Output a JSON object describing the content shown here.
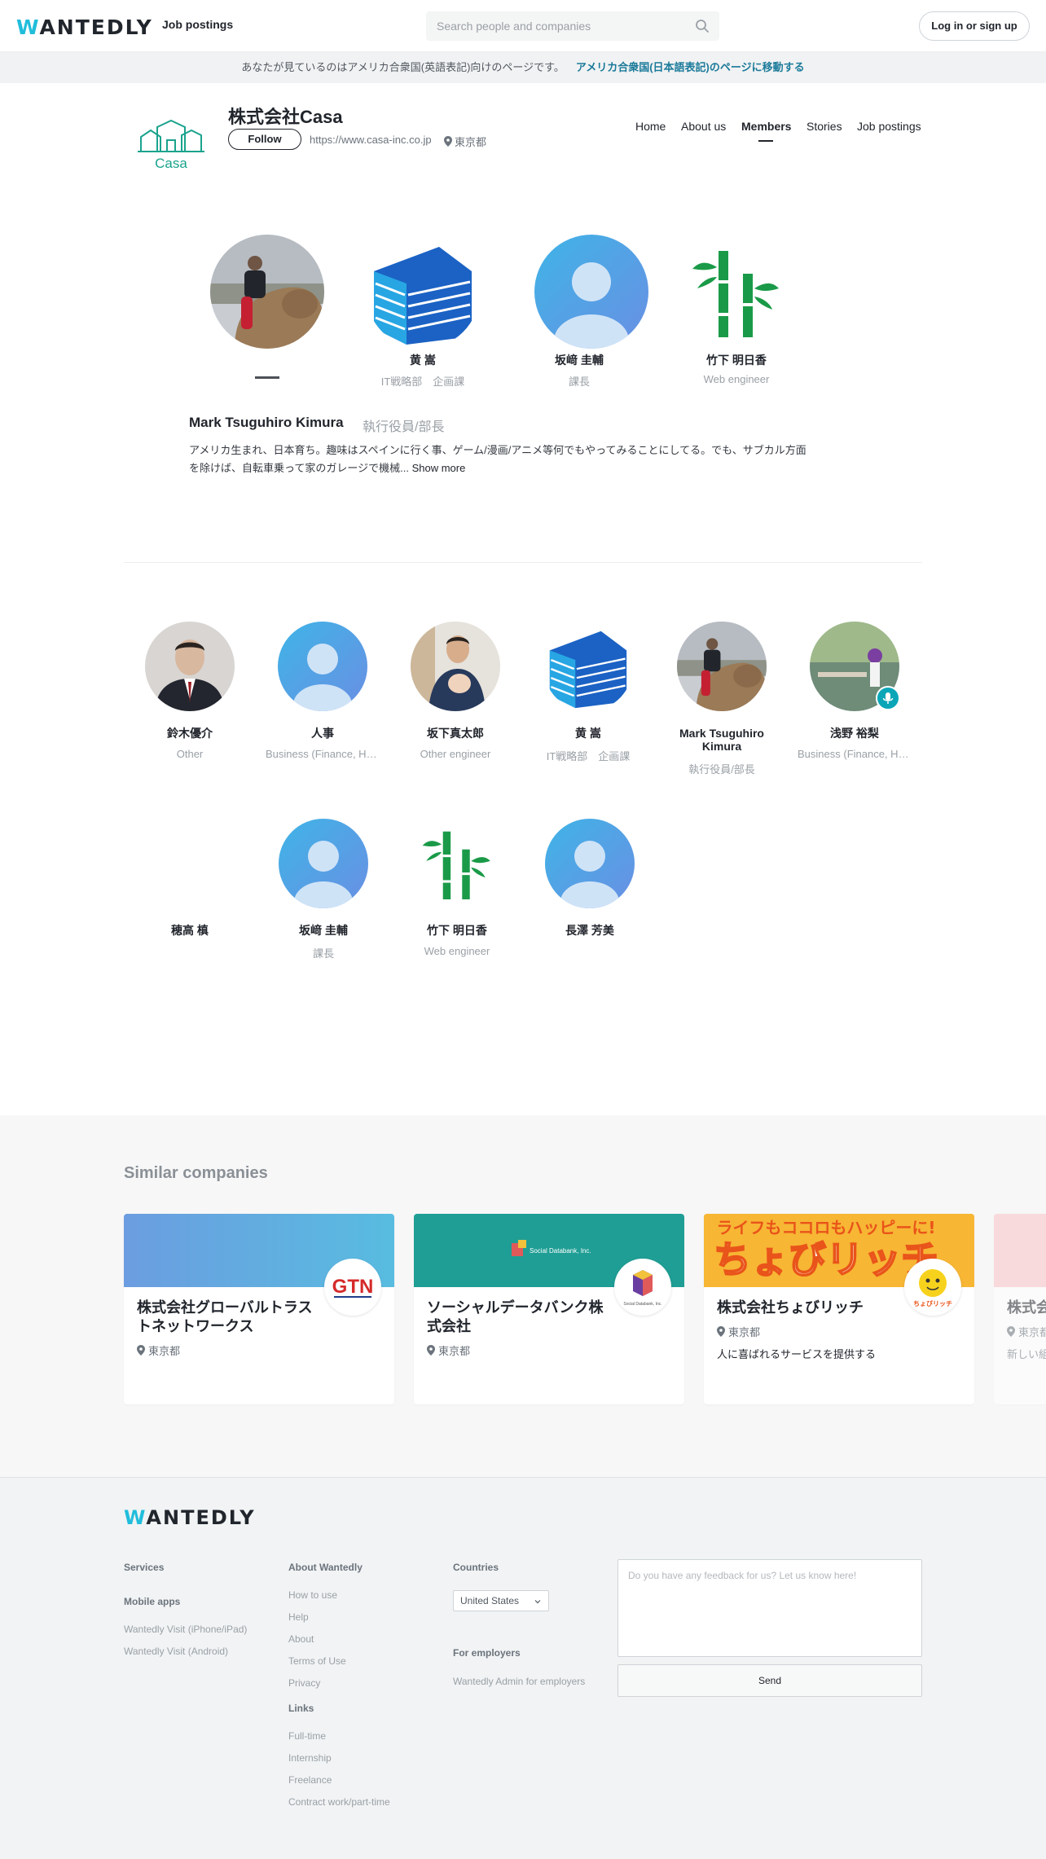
{
  "header": {
    "logo": "WANTEDLY",
    "nav_jobs": "Job postings",
    "search_placeholder": "Search people and companies",
    "login": "Log in or sign up"
  },
  "banner": {
    "message": "あなたが見ているのはアメリカ合衆国(英語表記)向けのページです。",
    "link": "アメリカ合衆国(日本語表記)のページに移動する"
  },
  "company": {
    "logo_text": "Casa",
    "name": "株式会社Casa",
    "follow": "Follow",
    "url": "https://www.casa-inc.co.jp",
    "location": "東京都",
    "nav": [
      "Home",
      "About us",
      "Members",
      "Stories",
      "Job postings"
    ],
    "active_nav": "Members"
  },
  "featured": [
    {
      "name": "",
      "role": "",
      "avatar": "photo-camel"
    },
    {
      "name": "黄 嵩",
      "role": "IT戦略部　企画課",
      "avatar": "building-logo"
    },
    {
      "name": "坂﨑 圭輔",
      "role": "課長",
      "avatar": "default-person"
    },
    {
      "name": "竹下 明日香",
      "role": "Web engineer",
      "avatar": "bamboo"
    }
  ],
  "selected_member": {
    "name": "Mark Tsuguhiro Kimura",
    "role": "執行役員/部長",
    "bio": "アメリカ生まれ、日本育ち。趣味はスペインに行く事、ゲーム/漫画/アニメ等何でもやってみることにしてる。でも、サブカル方面を除けば、自転車乗って家のガレージで機械...",
    "show_more": "Show more"
  },
  "members_row1": [
    {
      "name": "鈴木優介",
      "role": "Other",
      "avatar": "photo-suit"
    },
    {
      "name": "人事",
      "role": "Business (Finance, HR, etc.)",
      "avatar": "default-person"
    },
    {
      "name": "坂下真太郎",
      "role": "Other engineer",
      "avatar": "photo-baby"
    },
    {
      "name": "黄 嵩",
      "role": "IT戦略部　企画課",
      "avatar": "building-logo"
    },
    {
      "name": "Mark Tsuguhiro Kimura",
      "role": "執行役員/部長",
      "avatar": "photo-camel"
    },
    {
      "name": "浅野 裕梨",
      "role": "Business (Finance, HR, etc.)",
      "avatar": "photo-pond"
    }
  ],
  "members_row2": [
    {
      "name": "穂高 槙",
      "role": "",
      "avatar": "none"
    },
    {
      "name": "坂﨑 圭輔",
      "role": "課長",
      "avatar": "default-person"
    },
    {
      "name": "竹下 明日香",
      "role": "Web engineer",
      "avatar": "bamboo"
    },
    {
      "name": "長澤 芳美",
      "role": "",
      "avatar": "default-person"
    }
  ],
  "similar": {
    "title": "Similar companies",
    "cards": [
      {
        "name": "株式会社グローバルトラストネットワークス",
        "location": "東京都",
        "desc": "",
        "logo_text": "GTN",
        "cover_color": "#63a2e0"
      },
      {
        "name": "ソーシャルデータバンク株式会社",
        "location": "東京都",
        "desc": "",
        "logo_text": "Social Databank, Inc.",
        "cover_color": "#1f9e95"
      },
      {
        "name": "株式会社ちょびリッチ",
        "location": "東京都",
        "desc": "人に喜ばれるサービスを提供する",
        "logo_text": "ちょびリッチ",
        "cover_text": "ライフもココロもハッピーに!",
        "cover_title": "ちょびリッチ",
        "cover_color": "#f4a51c"
      },
      {
        "name": "株式会",
        "location": "東京都",
        "desc": "新しい組",
        "logo_text": "",
        "cover_color": "#fbc3c6"
      }
    ]
  },
  "footer": {
    "logo": "WANTEDLY",
    "services": "Services",
    "mobile_apps": "Mobile apps",
    "apps": [
      "Wantedly Visit (iPhone/iPad)",
      "Wantedly Visit (Android)"
    ],
    "about_heading": "About Wantedly",
    "about_links": [
      "How to use",
      "Help",
      "About",
      "Terms of Use",
      "Privacy"
    ],
    "links_heading": "Links",
    "links": [
      "Full-time",
      "Internship",
      "Freelance",
      "Contract work/part-time"
    ],
    "countries_heading": "Countries",
    "country": "United States",
    "employers_heading": "For employers",
    "employers_link": "Wantedly Admin for employers",
    "feedback_placeholder": "Do you have any feedback for us? Let us know here!",
    "send": "Send"
  }
}
